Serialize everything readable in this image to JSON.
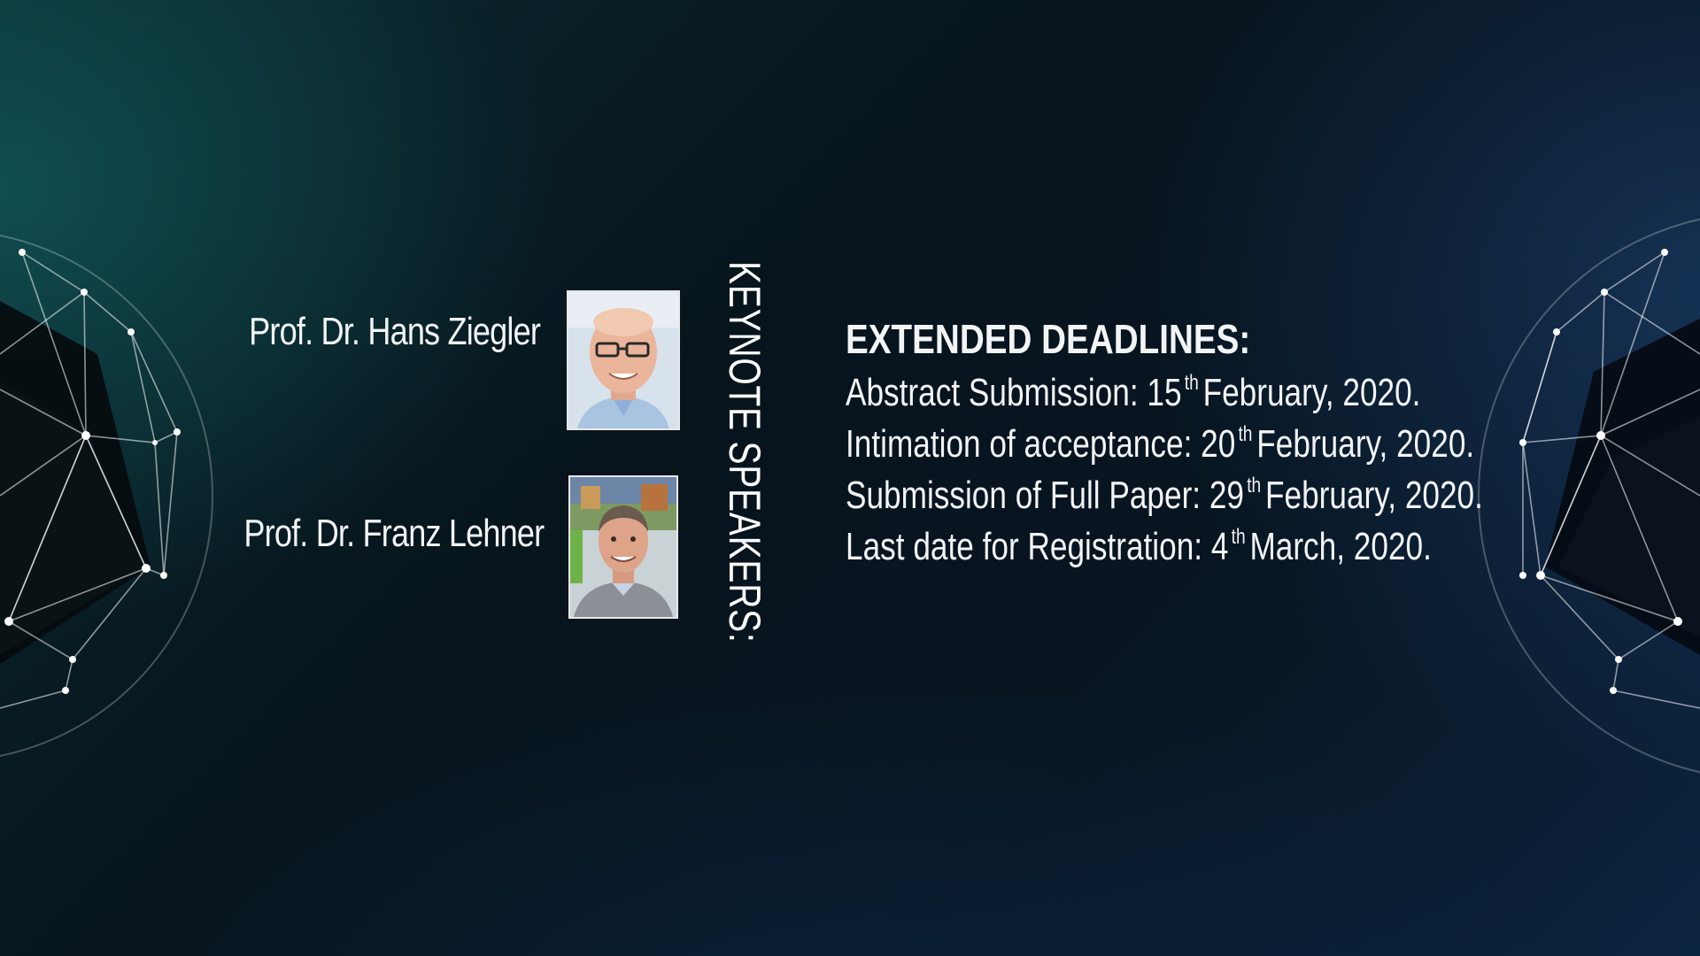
{
  "speakers": {
    "heading": "KEYNOTE SPEAKERS:",
    "list": [
      {
        "name": "Prof. Dr. Hans Ziegler"
      },
      {
        "name": "Prof. Dr. Franz Lehner"
      }
    ]
  },
  "deadlines": {
    "title": "EXTENDED DEADLINES:",
    "items": [
      {
        "label": "Abstract Submission: 15",
        "suffix": "th",
        "date": "February, 2020."
      },
      {
        "label": "Intimation of acceptance: 20",
        "suffix": "th",
        "date": "February, 2020."
      },
      {
        "label": "Submission of Full Paper: 29",
        "suffix": "th",
        "date": "February, 2020."
      },
      {
        "label": "Last date for Registration: 4",
        "suffix": "th",
        "date": "March, 2020."
      }
    ]
  },
  "colors": {
    "text": "#f2f4f6",
    "background": "#071520",
    "accent_teal": "#14706e",
    "accent_blue": "#1e4678"
  }
}
